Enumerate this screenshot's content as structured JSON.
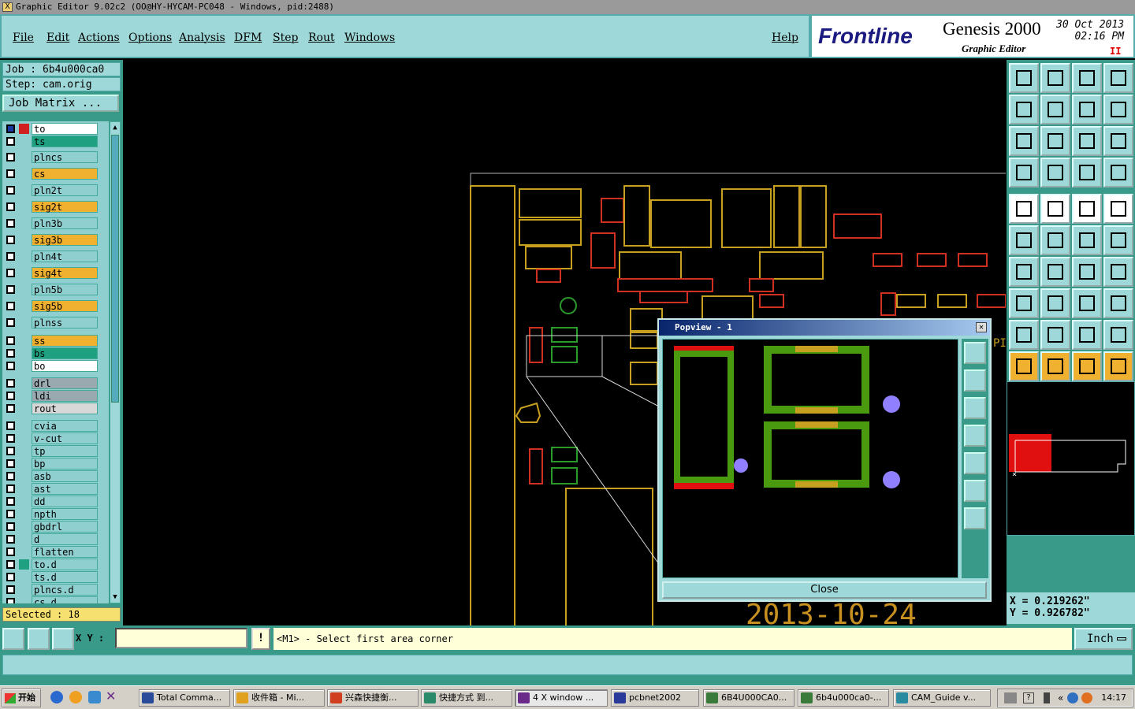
{
  "window": {
    "title": "Graphic Editor 9.02c2  (OO@HY-HYCAM-PC048 - Windows, pid:2488)"
  },
  "menu": {
    "items": [
      "File",
      "Edit",
      "Actions",
      "Options",
      "Analysis",
      "DFM",
      "Step",
      "Rout",
      "Windows"
    ],
    "help": "Help"
  },
  "brand": {
    "logo": "Frontline",
    "product": "Genesis 2000",
    "subtitle": "Graphic Editor",
    "date": "30 Oct 2013",
    "time": "02:16 PM",
    "pause": "II"
  },
  "job": {
    "job_line": "Job : 6b4u000ca0",
    "step_line": "Step: cam.orig",
    "matrix_button": "Job Matrix ..."
  },
  "layers": [
    {
      "name": "to",
      "color": "#ffffff"
    },
    {
      "name": "ts",
      "color": "#1fa080"
    },
    {
      "name": "plncs",
      "color": "#8fcfcf"
    },
    {
      "name": "cs",
      "color": "#f0b030"
    },
    {
      "name": "pln2t",
      "color": "#8fcfcf"
    },
    {
      "name": "sig2t",
      "color": "#f0b030"
    },
    {
      "name": "pln3b",
      "color": "#8fcfcf"
    },
    {
      "name": "sig3b",
      "color": "#f0b030"
    },
    {
      "name": "pln4t",
      "color": "#8fcfcf"
    },
    {
      "name": "sig4t",
      "color": "#f0b030"
    },
    {
      "name": "pln5b",
      "color": "#8fcfcf"
    },
    {
      "name": "sig5b",
      "color": "#f0b030"
    },
    {
      "name": "plnss",
      "color": "#8fcfcf"
    },
    {
      "name": "ss",
      "color": "#f0b030"
    },
    {
      "name": "bs",
      "color": "#1fa080"
    },
    {
      "name": "bo",
      "color": "#ffffff"
    },
    {
      "name": "drl",
      "color": "#9aa8b0"
    },
    {
      "name": "ldi",
      "color": "#9aa8b0"
    },
    {
      "name": "rout",
      "color": "#d8d8d8"
    },
    {
      "name": "cvia",
      "color": "#8fcfcf"
    },
    {
      "name": "v-cut",
      "color": "#8fcfcf"
    },
    {
      "name": "tp",
      "color": "#8fcfcf"
    },
    {
      "name": "bp",
      "color": "#8fcfcf"
    },
    {
      "name": "asb",
      "color": "#8fcfcf"
    },
    {
      "name": "ast",
      "color": "#8fcfcf"
    },
    {
      "name": "dd",
      "color": "#8fcfcf"
    },
    {
      "name": "npth",
      "color": "#8fcfcf"
    },
    {
      "name": "gbdrl",
      "color": "#8fcfcf"
    },
    {
      "name": "d",
      "color": "#8fcfcf"
    },
    {
      "name": "flatten",
      "color": "#8fcfcf"
    },
    {
      "name": "to.d",
      "color": "#8fcfcf"
    },
    {
      "name": "ts.d",
      "color": "#8fcfcf"
    },
    {
      "name": "plncs.d",
      "color": "#8fcfcf"
    },
    {
      "name": "cs.d",
      "color": "#8fcfcf"
    }
  ],
  "selected": "Selected : 18",
  "canvas": {
    "date_text": "2013-10-24",
    "edge_label": "PI"
  },
  "popview": {
    "title": "Popview - 1",
    "close_label": "Close"
  },
  "coords": {
    "x": "X = 0.219262\"",
    "y": "Y = 0.926782\""
  },
  "cmd": {
    "xy_label": "X Y :",
    "xy_value": "",
    "warn": "!",
    "prompt": "<M1> - Select first area corner",
    "unit": "Inch"
  },
  "taskbar": {
    "start": "开始",
    "tasks": [
      "Total Comma...",
      "收件箱 - Mi...",
      "兴森快捷衡...",
      "快捷方式 到...",
      "4 X window ...",
      "pcbnet2002",
      "6B4U000CA0...",
      "6b4u000ca0-...",
      "CAM_Guide v..."
    ],
    "clock": "14:17"
  }
}
